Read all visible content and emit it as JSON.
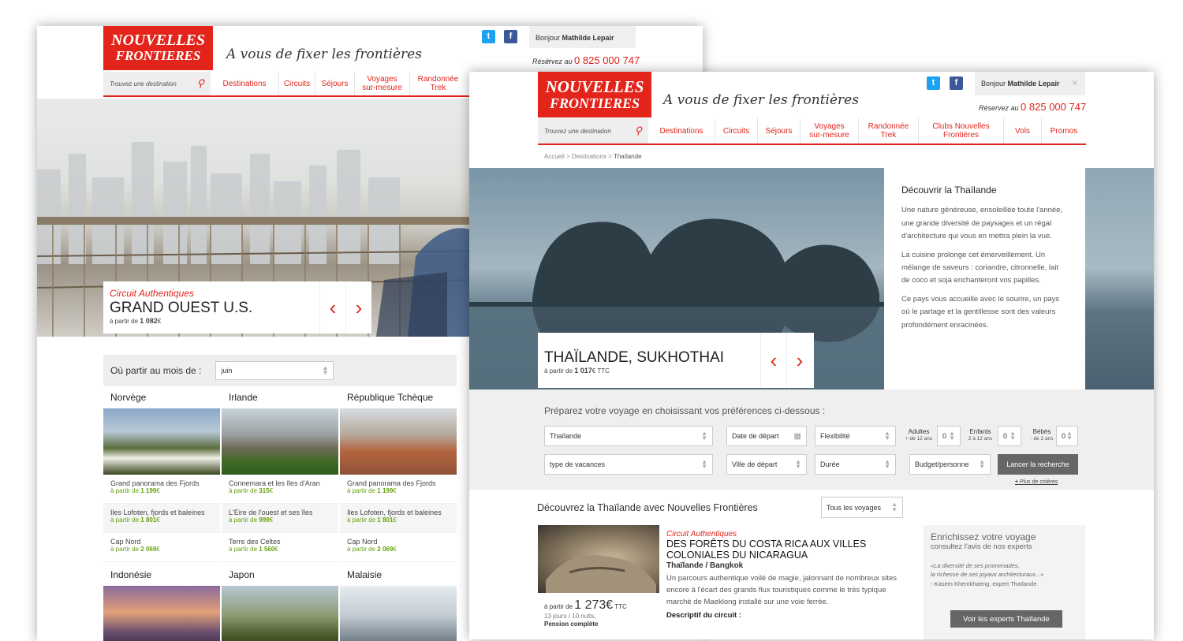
{
  "brand": {
    "line1": "NOUVELLES",
    "line2": "FRONTIERES",
    "tagline": "A vous de fixer les frontières"
  },
  "social": {
    "twitter_glyph": "t",
    "facebook_glyph": "f"
  },
  "account": {
    "greeting": "Bonjour",
    "user": "Mathilde Lepair",
    "close_glyph": "✕"
  },
  "phone": {
    "label": "Réservez au",
    "number": "0 825 000 747"
  },
  "search": {
    "placeholder": "Trouvez une destination",
    "icon": "search-icon"
  },
  "nav": {
    "destinations": "Destinations",
    "circuits": "Circuits",
    "sejours": "Séjours",
    "voyages_l1": "Voyages",
    "voyages_l2": "sur-mesure",
    "randonnee_l1": "Randonnée",
    "randonnee_l2": "Trek",
    "clubs_l1": "Clubs Nouvelles",
    "clubs_l2": "Frontières",
    "vols": "Vols",
    "promos": "Promos"
  },
  "back_page": {
    "hero": {
      "kind": "Circuit Authentiques",
      "name": "GRAND OUEST U.S.",
      "price_prefix": "à partir de",
      "price": "1 082",
      "currency": "€"
    },
    "month_filter": {
      "label": "Où partir au mois de :",
      "value": "juin"
    },
    "destinations": [
      {
        "title": "Norvège",
        "items": [
          {
            "name": "Grand panorama des Fjords",
            "prefix": "à partir de",
            "price": "1 199",
            "cur": "€"
          },
          {
            "name": "Iles Lofoten, fjords et baleines",
            "prefix": "à partir de",
            "price": "1 801",
            "cur": "€"
          },
          {
            "name": "Cap Nord",
            "prefix": "à partir de",
            "price": "2 069",
            "cur": "€"
          }
        ]
      },
      {
        "title": "Irlande",
        "items": [
          {
            "name": "Connemara et les îles d'Aran",
            "prefix": "à partir de",
            "price": "315",
            "cur": "€"
          },
          {
            "name": "L'Eire de l'ouest et ses îles",
            "prefix": "à partir de",
            "price": "999",
            "cur": "€"
          },
          {
            "name": "Terre des Celtes",
            "prefix": "à partir de",
            "price": "1 560",
            "cur": "€"
          }
        ]
      },
      {
        "title": "République Tchèque",
        "items": [
          {
            "name": "Grand panorama des Fjords",
            "prefix": "à partir de",
            "price": "1 199",
            "cur": "€"
          },
          {
            "name": "Iles Lofoten, fjords et baleines",
            "prefix": "à partir de",
            "price": "1 801",
            "cur": "€"
          },
          {
            "name": "Cap Nord",
            "prefix": "à partir de",
            "price": "2 069",
            "cur": "€"
          }
        ]
      },
      {
        "title": "Indonésie",
        "items": []
      },
      {
        "title": "Japon",
        "items": []
      },
      {
        "title": "Malaisie",
        "items": []
      }
    ]
  },
  "front_page": {
    "breadcrumb": [
      "Accueil",
      "Destinations",
      "Thaïlande"
    ],
    "hero": {
      "name": "THAÏLANDE, SUKHOTHAI",
      "price_prefix": "à partir de",
      "price": "1 017",
      "currency": "€ TTC"
    },
    "discover": {
      "title": "Découvrir la Thaïlande",
      "p1": "Une nature généreuse, ensoleillée toute l'année, une grande diversité de paysages et un régal d'architecture qui vous en mettra plein la vue.",
      "p2": "La cuisine prolonge cet émerveillement. Un mélange de saveurs : coriandre, citronnelle, lait de coco et soja enchanteront vos papilles.",
      "p3": "Ce pays vous accueille avec le sourire, un pays où le partage et la gentillesse sont des valeurs profondément enracinées."
    },
    "prefs": {
      "title": "Préparez votre voyage en choisissant vos préférences ci-dessous :",
      "destination": "Thaïlande",
      "date": "Date de départ",
      "flex": "Flexibilité",
      "type": "type de vacances",
      "city": "Ville de départ",
      "duration": "Durée",
      "budget": "Budget/personne",
      "adults": "Adultes",
      "adults_sub": "+ de 12 ans",
      "adults_val": "0",
      "kids": "Enfants",
      "kids_sub": "2 à 12 ans",
      "kids_val": "0",
      "babies": "Bébés",
      "babies_sub": "- de 2 ans",
      "babies_val": "0",
      "search_button": "Lancer la recherche",
      "more": "Plus de critères",
      "more_plus": "+"
    },
    "listing": {
      "title": "Découvrez la Thaïlande avec Nouvelles Frontières",
      "filter": "Tous les voyages"
    },
    "trip": {
      "kind": "Circuit Authentiques",
      "name_l1": "DES FORÊTS DU COSTA RICA AUX VILLES",
      "name_l2": "COLONIALES DU NICARAGUA",
      "place": "Thaïlande / Bangkok",
      "desc": "Un parcours authentique voilé de magie, jalonnant de nombreux sites encore à l'écart des grands flux touristiques comme le très typique marché de Maeklong installé sur une voie ferrée.",
      "sub": "Descriptif du circuit :",
      "price_prefix": "à partir de",
      "price": "1 273€",
      "price_suffix": "TTC",
      "nights": "13 jours / 10 nuits,",
      "board": "Pension complète"
    },
    "experts": {
      "title": "Enrichissez votre voyage",
      "subtitle": "consultez l'avis de nos experts",
      "quote_l1": "«La diversité de ses promenades,",
      "quote_l2": "la richesse de ses joyaux architecturaux...»",
      "author": "- Kasem Khemkhaeng, expert Thaïlande",
      "button": "Voir les experts Thaïlande"
    }
  }
}
